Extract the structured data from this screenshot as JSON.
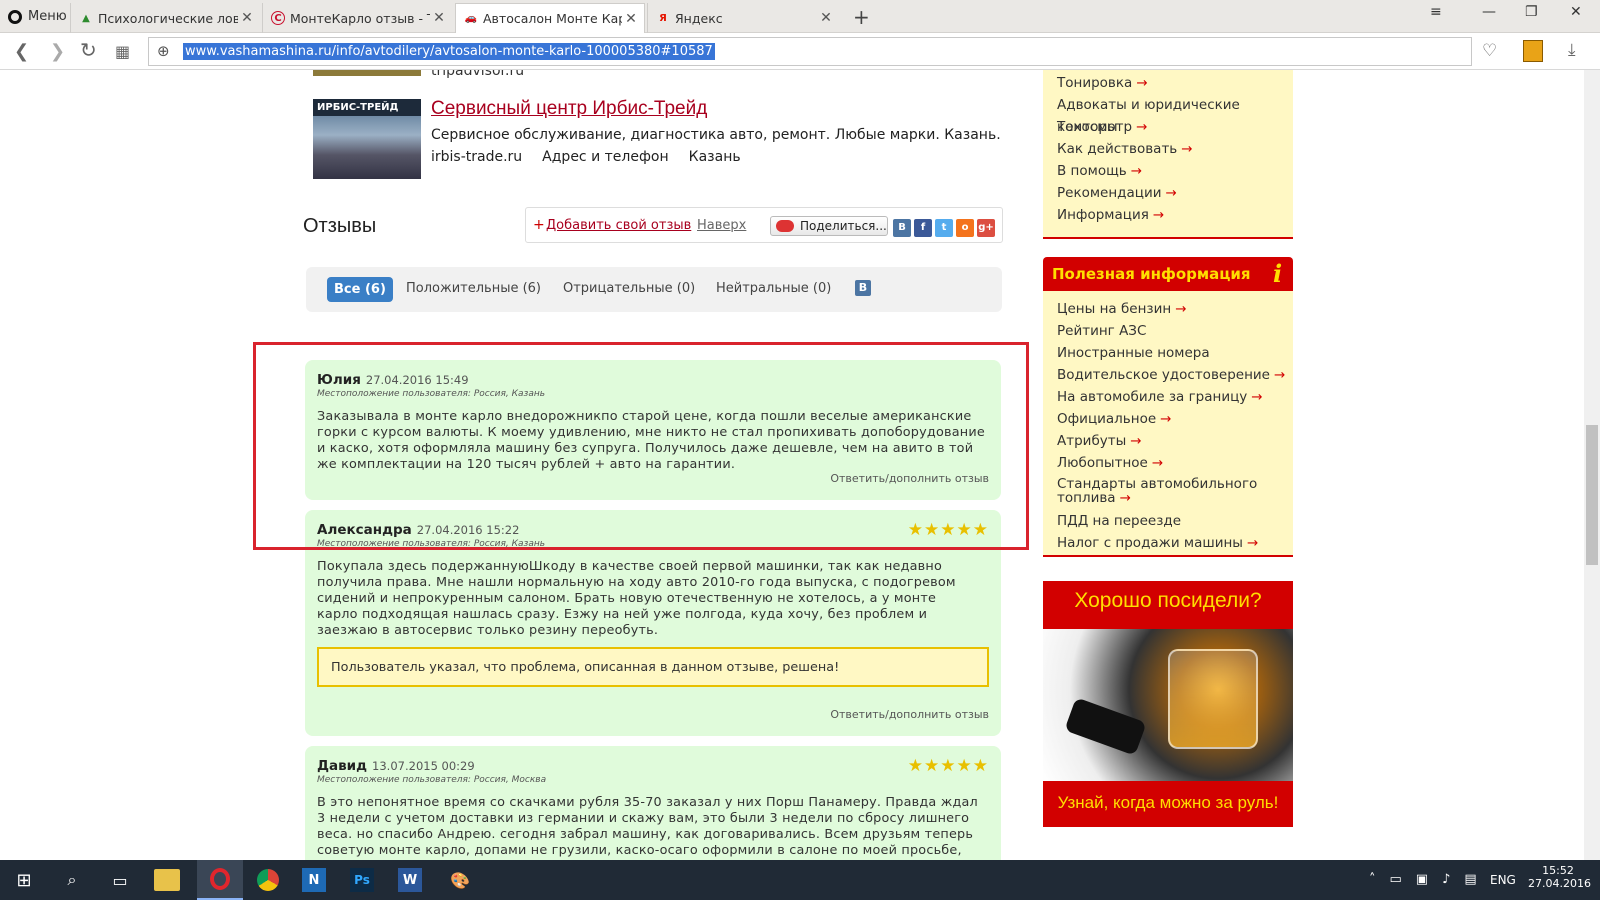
{
  "browser": {
    "menu_label": "Меню",
    "tabs": [
      {
        "label": "Психологические ловушк",
        "fav": "▲"
      },
      {
        "label": "МонтеКарло отзыв - ТЗ-Т",
        "fav": "C"
      },
      {
        "label": "Автосалон Монте Карло",
        "fav": "🚗"
      },
      {
        "label": "Яндекс",
        "fav": "Я"
      }
    ],
    "url": "www.vashamashina.ru/info/avtodilery/avtosalon-monte-karlo-100005380#10587"
  },
  "services": {
    "prev_partial_text": "tripadvisor.ru",
    "item": {
      "thumb_label": "ИРБИС-ТРЕЙД",
      "title": "Сервисный центр Ирбис-Трейд",
      "desc": "Сервисное обслуживание, диагностика авто, ремонт. Любые марки. Казань.",
      "site": "irbis-trade.ru",
      "address": "Адрес и телефон",
      "city": "Казань"
    }
  },
  "reviews_header": {
    "title": "Отзывы",
    "add_plus": "+",
    "add_label": "Добавить свой отзыв",
    "top_label": "Наверх",
    "share_label": "Поделиться...",
    "social": [
      {
        "name": "vk-icon",
        "glyph": "B",
        "color": "#4c75a3"
      },
      {
        "name": "facebook-icon",
        "glyph": "f",
        "color": "#3b5998"
      },
      {
        "name": "twitter-icon",
        "glyph": "t",
        "color": "#55acee"
      },
      {
        "name": "odnoklassniki-icon",
        "glyph": "o",
        "color": "#f4731c"
      },
      {
        "name": "googleplus-icon",
        "glyph": "g+",
        "color": "#dc4e41"
      }
    ]
  },
  "filters": {
    "all": "Все (6)",
    "positive": "Положительные (6)",
    "negative": "Отрицательные (0)",
    "neutral": "Нейтральные (0)",
    "vk": "B"
  },
  "reviews": [
    {
      "name": "Юлия",
      "date": "27.04.2016 15:49",
      "location": "Местоположение пользователя: Россия, Казань",
      "text": "Заказывала в монте карло внедорожникпо старой цене, когда пошли веселые американские горки с курсом валюты. К моему удивлению, мне никто не стал пропихивать допоборудование и каско, хотя оформляла машину без супруга. Получилось даже дешевле, чем на авито в той же комплектации на 120 тысяч рублей + авто на гарантии.",
      "reply": "Ответить/дополнить отзыв"
    },
    {
      "name": "Александра",
      "date": "27.04.2016 15:22",
      "location": "Местоположение пользователя: Россия, Казань",
      "stars": "★★★★★",
      "rating": 5,
      "text": "Покупала здесь подержаннуюШкоду в качестве своей первой машинки, так как недавно получила права. Мне нашли нормальную на ходу авто 2010-го года выпуска, с подогревом сидений и непрокуренным салоном. Брать новую отечественную не хотелось, а у монте карло подходящая нашлась сразу. Езжу на ней уже полгода, куда хочу, без проблем и заезжаю в автосервис только резину переобуть.",
      "resolved_note": "Пользователь указал, что проблема, описанная в данном отзыве, решена!",
      "reply": "Ответить/дополнить отзыв"
    },
    {
      "name": "Давид",
      "date": "13.07.2015 00:29",
      "location": "Местоположение пользователя: Россия, Москва",
      "stars": "★★★★★",
      "rating": 5,
      "text": "В это непонятное время со скачками рубля 35-70 заказал у них Порш Панамеру. Правда ждал 3 недели с учетом доставки из германии и скажу вам, это были 3 недели по сбросу лишнего веса. но спасибо Андрею. сегодня забрал машину, как договаривались. Всем друзьям теперь советую монте карло, допами не грузили, каско-осаго оформили в салоне по моей просьбе, ничего не"
    }
  ],
  "sidebar": {
    "top_items": [
      {
        "label": "Тонировка",
        "arrow": "→"
      },
      {
        "label": "Адвокаты и юридические конторы",
        "arrow": ""
      },
      {
        "label": "Техосмотр",
        "arrow": "→"
      },
      {
        "label": "Как действовать",
        "arrow": "→"
      },
      {
        "label": "В помощь",
        "arrow": "→"
      },
      {
        "label": "Рекомендации",
        "arrow": "→"
      },
      {
        "label": "Информация",
        "arrow": "→"
      }
    ],
    "useful_title": "Полезная информация",
    "useful_icon": "i",
    "useful_items": [
      {
        "label": "Цены на бензин",
        "arrow": "→"
      },
      {
        "label": "Рейтинг АЗС",
        "arrow": ""
      },
      {
        "label": "Иностранные номера",
        "arrow": ""
      },
      {
        "label": "Водительское удостоверение",
        "arrow": "→"
      },
      {
        "label": "На автомобиле за границу",
        "arrow": "→"
      },
      {
        "label": "Официальное",
        "arrow": "→"
      },
      {
        "label": "Атрибуты",
        "arrow": "→"
      },
      {
        "label": "Любопытное",
        "arrow": "→"
      },
      {
        "label": "Стандарты автомобильного топлива",
        "arrow": "→"
      },
      {
        "label": "ПДД на переезде",
        "arrow": ""
      },
      {
        "label": "Налог с продажи машины",
        "arrow": "→"
      }
    ],
    "ad_top": "Хорошо посидели?",
    "ad_bottom": "Узнай, когда можно за руль!"
  },
  "taskbar": {
    "lang": "ENG",
    "time": "15:52",
    "date": "27.04.2016"
  },
  "colors": {
    "review_bg": "#e0fbdb",
    "highlight_frame": "#d9232d",
    "sidebar_bg": "#fff8c4",
    "accent_red": "#d20000",
    "active_filter": "#3a7fc6"
  }
}
